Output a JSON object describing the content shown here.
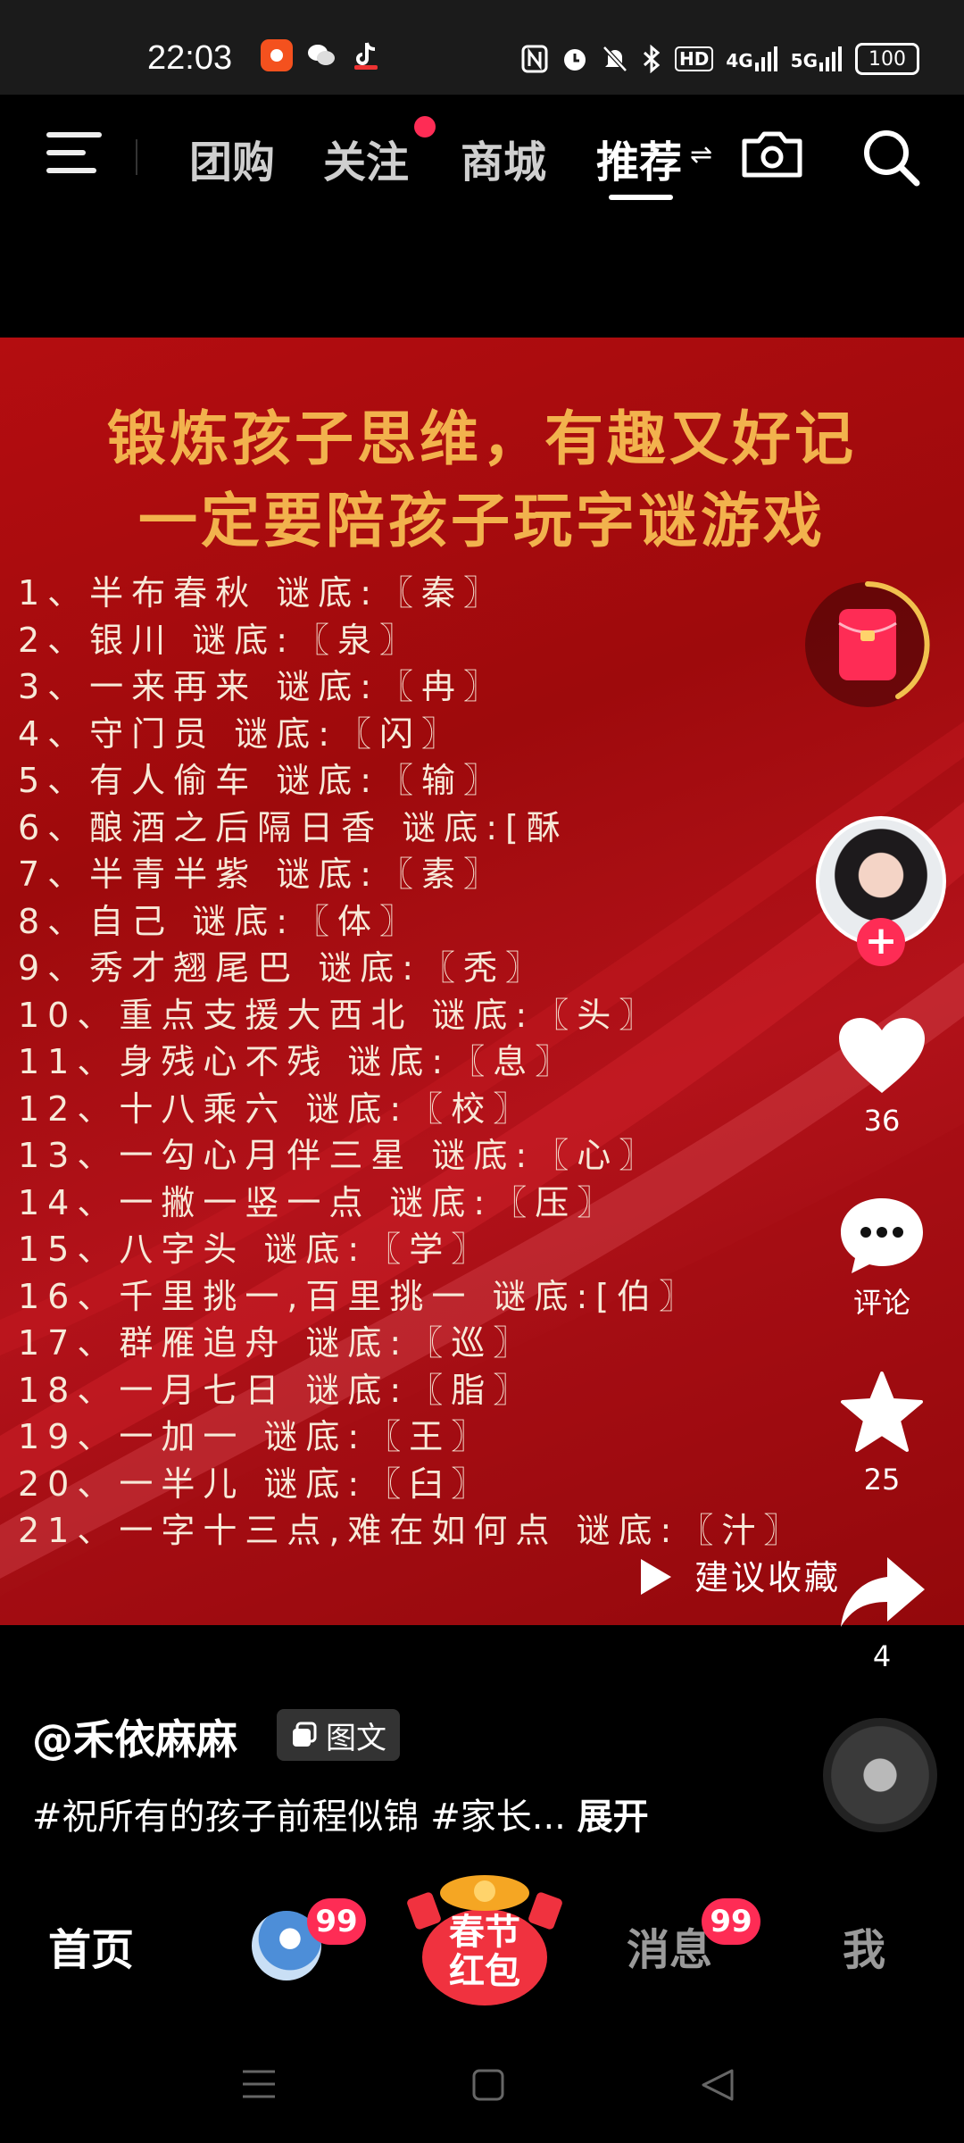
{
  "status_bar": {
    "time": "22:03",
    "battery": "100",
    "network_label": "4G",
    "network_label_2": "5G",
    "hd_label": "HD",
    "icons": [
      "camera-app-icon",
      "wechat-icon",
      "tiktok-icon",
      "nfc-icon",
      "alarm-icon",
      "mute-icon",
      "bluetooth-icon"
    ]
  },
  "top_nav": {
    "tabs": [
      {
        "label": "团购"
      },
      {
        "label": "关注"
      },
      {
        "label": "商城"
      },
      {
        "label": "推荐"
      }
    ],
    "active_tab": "推荐",
    "icons": [
      "menu-icon",
      "camera-icon",
      "search-icon"
    ]
  },
  "post": {
    "title_line1": "锻炼孩子思维，有趣又好记",
    "title_line2": "一定要陪孩子玩字谜游戏",
    "riddles": [
      "1、半布春秋 谜底:〖秦〗",
      "2、银川 谜底:〖泉〗",
      "3、一来再来 谜底:〖冉〗",
      "4、守门员 谜底:〖闪〗",
      "5、有人偷车 谜底:〖输〗",
      "6、酿酒之后隔日香 谜底:[酥",
      "7、半青半紫 谜底:〖素〗",
      "8、自己 谜底:〖体〗",
      "9、秀才翘尾巴 谜底:〖秃〗",
      "10、重点支援大西北 谜底:〖头〗",
      "11、身残心不残 谜底:〖息〗",
      "12、十八乘六 谜底:〖校〗",
      "13、一勾心月伴三星 谜底:〖心〗",
      "14、一撇一竖一点 谜底:〖压〗",
      "15、八字头 谜底:〖学〗",
      "16、千里挑一,百里挑一 谜底:[伯〗",
      "17、群雁追舟 谜底:〖巡〗",
      "18、一月七日 谜底:〖脂〗",
      "19、一加一 谜底:〖王〗",
      "20、一半儿 谜底:〖臼〗",
      "21、一字十三点,难在如何点 谜底:〖汁〗"
    ],
    "collect_hint": "建议收藏"
  },
  "side_rail": {
    "likes": "36",
    "comments_label": "评论",
    "favorites": "25",
    "shares": "4"
  },
  "caption": {
    "author": "@禾依麻麻",
    "type_tag": "图文",
    "text": "#祝所有的孩子前程似锦 #家长...",
    "expand": "展开"
  },
  "bottom_nav": {
    "home": "首页",
    "friends_badge": "99",
    "festival_line1": "春节",
    "festival_line2": "红包",
    "messages": "消息",
    "messages_badge": "99",
    "me": "我"
  },
  "colors": {
    "accent": "#fe2c55",
    "title_gold": "#f2b24d",
    "post_red": "#b40d10"
  }
}
